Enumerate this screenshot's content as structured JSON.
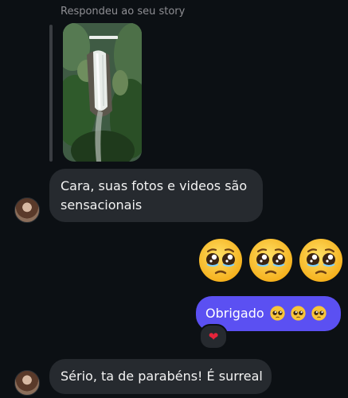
{
  "story_reply": {
    "note": "Respondeu ao seu story"
  },
  "messages": {
    "incoming_1": "Cara, suas fotos e videos são sensacionais",
    "outgoing_1": "Obrigado",
    "incoming_2": "Sério, ta de parabéns! É surreal"
  },
  "emojis": {
    "big_row": [
      "pleading-face",
      "pleading-face",
      "pleading-face"
    ],
    "inline_after_outgoing": [
      "pleading-face",
      "pleading-face",
      "pleading-face"
    ]
  },
  "reaction": {
    "symbol": "❤",
    "color": "#e5243b"
  },
  "colors": {
    "background": "#0c1014",
    "incoming_bubble": "#262a2f",
    "outgoing_bubble": "#5b50f2"
  }
}
